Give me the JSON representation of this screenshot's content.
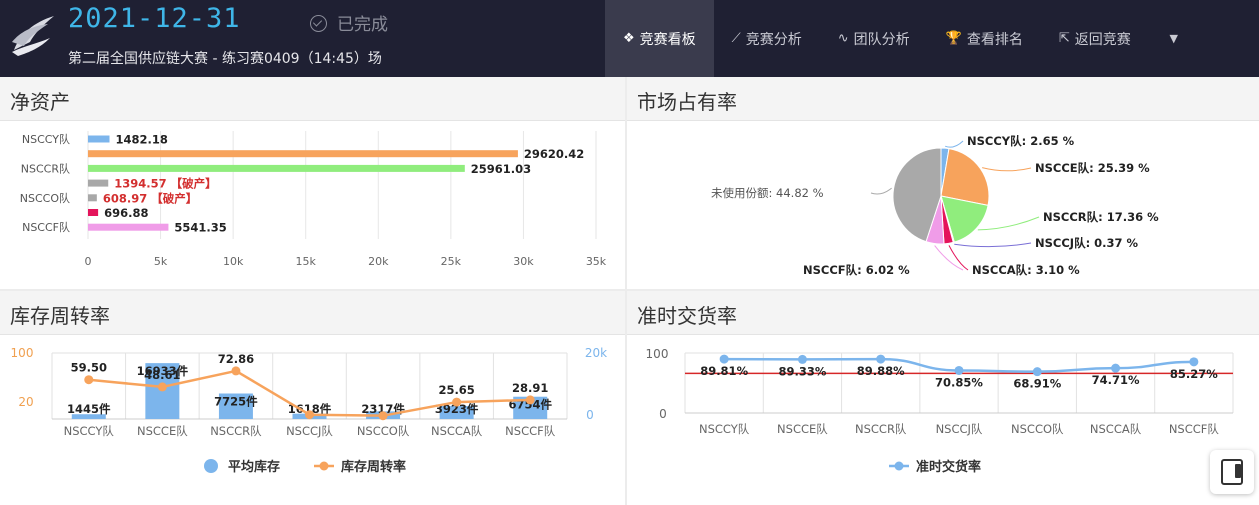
{
  "header": {
    "date": "2021-12-31",
    "status": "已完成",
    "subtitle": "第二届全国供应链大赛 - 练习赛0409（14:45）场",
    "nav": [
      {
        "label": "竞赛看板",
        "icon": "dashboard-icon",
        "glyph": "❖",
        "active": true
      },
      {
        "label": "竞赛分析",
        "icon": "line-chart-icon",
        "glyph": "⟋",
        "active": false
      },
      {
        "label": "团队分析",
        "icon": "pulse-icon",
        "glyph": "∿",
        "active": false
      },
      {
        "label": "查看排名",
        "icon": "trophy-icon",
        "glyph": "🏆",
        "active": false
      },
      {
        "label": "返回竞赛",
        "icon": "external-link-icon",
        "glyph": "⇱",
        "active": false
      }
    ]
  },
  "panels": {
    "net_assets": "净资产",
    "market_share": "市场占有率",
    "inventory_turnover": "库存周转率",
    "on_time_delivery": "准时交货率"
  },
  "chart_data": [
    {
      "type": "bar",
      "orientation": "horizontal",
      "categories": [
        "NSCCY队",
        "NSCCE队",
        "NSCCR队",
        "NSCCJ队",
        "NSCCO队",
        "NSCCA队",
        "NSCCF队"
      ],
      "axis_categories_shown": [
        "NSCCY队",
        "NSCCR队",
        "NSCCO队",
        "NSCCF队"
      ],
      "values": [
        1482.18,
        29620.42,
        25961.03,
        1394.57,
        608.97,
        696.88,
        5541.35
      ],
      "value_labels": [
        "1482.18",
        "29620.42",
        "25961.03",
        "1394.57 【破产】",
        "608.97 【破产】",
        "696.88",
        "5541.35"
      ],
      "bankrupt": [
        false,
        false,
        false,
        true,
        true,
        false,
        false
      ],
      "colors": [
        "#7cb5ec",
        "#f7a35c",
        "#90ed7d",
        "#a8a8a8",
        "#a8a8a8",
        "#e4145b",
        "#f09ce8"
      ],
      "xticks": [
        "0",
        "5k",
        "10k",
        "15k",
        "20k",
        "25k",
        "30k",
        "35k"
      ],
      "xlim": [
        0,
        35000
      ],
      "grid": true
    },
    {
      "type": "pie",
      "labels": [
        "NSCCY队: 2.65 %",
        "NSCCE队: 25.39 %",
        "NSCCR队: 17.36 %",
        "NSCCJ队: 0.37 %",
        "NSCCA队: 3.10 %",
        "NSCCF队: 6.02 %",
        "未使用份额: 44.82 %"
      ],
      "values": [
        2.65,
        25.39,
        17.36,
        0.37,
        3.1,
        6.02,
        44.82
      ],
      "colors": [
        "#7cb5ec",
        "#f7a35c",
        "#90ed7d",
        "#7a6fd6",
        "#e4145b",
        "#f09ce8",
        "#a9a9a9"
      ]
    },
    {
      "type": "bar+line",
      "categories": [
        "NSCCY队",
        "NSCCE队",
        "NSCCR队",
        "NSCCJ队",
        "NSCCO队",
        "NSCCA队",
        "NSCCF队"
      ],
      "series": [
        {
          "name": "平均库存",
          "type": "bar",
          "values": [
            1445,
            16933,
            7725,
            1618,
            2317,
            3923,
            6754
          ],
          "labels": [
            "1445件",
            "16933件",
            "7725件",
            "1618件",
            "2317件",
            "3923件",
            "6754件"
          ],
          "color": "#7cb5ec",
          "axis": "right"
        },
        {
          "name": "库存周转率",
          "type": "line",
          "values": [
            59.5,
            48.61,
            72.86,
            6.5,
            5.0,
            25.65,
            28.91
          ],
          "labels": [
            "59.50",
            "48.61",
            "72.86",
            "",
            "",
            "25.65",
            "28.91"
          ],
          "color": "#f7a35c",
          "axis": "left"
        }
      ],
      "yticks_left": [
        "100",
        "20"
      ],
      "yticks_right": [
        "20k",
        "0"
      ],
      "ylim_left": [
        0,
        100
      ],
      "ylim_right": [
        0,
        20000
      ],
      "legend_position": "bottom"
    },
    {
      "type": "line",
      "categories": [
        "NSCCY队",
        "NSCCE队",
        "NSCCR队",
        "NSCCJ队",
        "NSCCO队",
        "NSCCA队",
        "NSCCF队"
      ],
      "series": [
        {
          "name": "准时交货率",
          "values": [
            89.81,
            89.33,
            89.88,
            70.85,
            68.91,
            74.71,
            85.27
          ],
          "labels": [
            "89.81%",
            "89.33%",
            "89.88%",
            "70.85%",
            "68.91%",
            "74.71%",
            "85.27%"
          ],
          "color": "#7cb5ec"
        }
      ],
      "reference_line": {
        "value": 66,
        "color": "#d62728"
      },
      "yticks": [
        "100",
        "0"
      ],
      "ylim": [
        0,
        100
      ],
      "legend_position": "bottom"
    }
  ]
}
